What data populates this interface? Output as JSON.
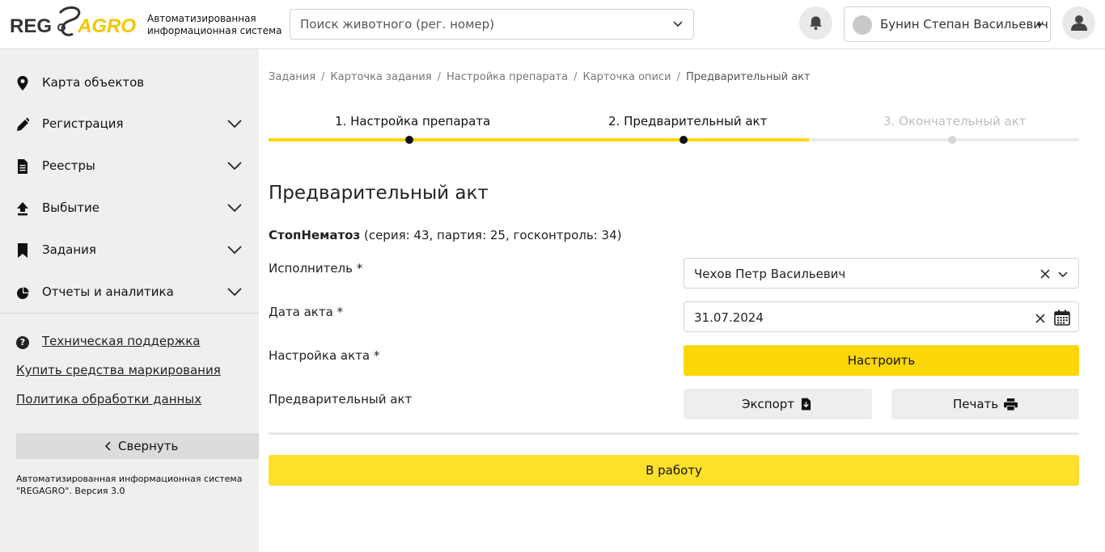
{
  "header": {
    "logo_text_left": "REG",
    "logo_text_right": "AGRO",
    "system_name_line1": "Автоматизированная",
    "system_name_line2": "информационная система",
    "search_placeholder": "Поиск животного (рег. номер)",
    "user_name": "Бунин Степан Васильевич"
  },
  "sidebar": {
    "items": [
      {
        "label": "Карта объектов",
        "icon": "map-marker-icon",
        "expandable": false
      },
      {
        "label": "Регистрация",
        "icon": "pencil-icon",
        "expandable": true
      },
      {
        "label": "Реестры",
        "icon": "document-icon",
        "expandable": true
      },
      {
        "label": "Выбытие",
        "icon": "upload-icon",
        "expandable": true
      },
      {
        "label": "Задания",
        "icon": "bookmark-icon",
        "expandable": true
      },
      {
        "label": "Отчеты и аналитика",
        "icon": "pie-chart-icon",
        "expandable": true
      }
    ],
    "links": {
      "support": "Техническая поддержка",
      "buy": "Купить средства маркирования",
      "policy": "Политика обработки данных"
    },
    "collapse_label": "Свернуть",
    "footer_line1": "Автоматизированная информационная система",
    "footer_line2": "\"REGAGRO\". Версия 3.0"
  },
  "breadcrumb": [
    "Задания",
    "Карточка задания",
    "Настройка препарата",
    "Карточка описи",
    "Предварительный акт"
  ],
  "breadcrumb_separator": "/",
  "stepper": {
    "steps": [
      {
        "label": "1. Настройка препарата",
        "state": "done"
      },
      {
        "label": "2. Предварительный акт",
        "state": "active"
      },
      {
        "label": "3. Окончательный акт",
        "state": "disabled"
      }
    ],
    "progress_fraction": 0.667,
    "accent_color": "#fcd70a"
  },
  "main": {
    "title": "Предварительный акт",
    "drug_name": "СтопНематоз",
    "drug_details": " (серия: 43, партия: 25, госконтроль: 34)",
    "executor_label": "Исполнитель *",
    "executor_value": "Чехов Петр Васильевич",
    "date_label": "Дата акта *",
    "date_value": "31.07.2024",
    "setup_label": "Настройка акта *",
    "setup_button": "Настроить",
    "preliminary_label": "Предварительный акт",
    "export_button": "Экспорт",
    "print_button": "Печать",
    "work_button": "В работу"
  },
  "colors": {
    "accent": "#fcd70a",
    "sidebar_bg": "#efefef"
  }
}
